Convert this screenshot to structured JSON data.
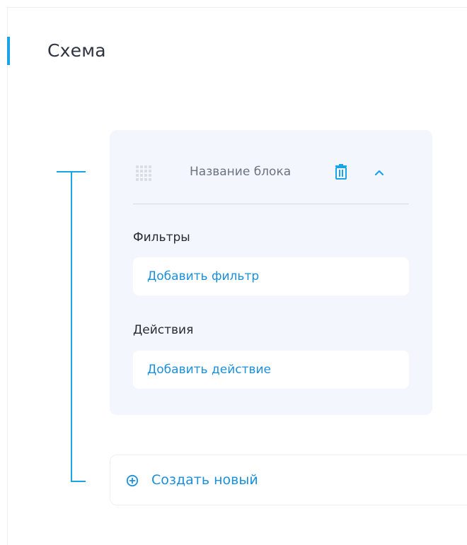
{
  "page": {
    "title": "Схема",
    "accent_color": "#1ba3e8",
    "link_color": "#1b8fd9"
  },
  "block": {
    "name": "Название блока",
    "drag_icon": "drag-handle-icon",
    "delete_icon": "trash-icon",
    "collapse_icon": "chevron-up-icon",
    "filters": {
      "label": "Фильтры",
      "add_label": "Добавить фильтр"
    },
    "actions": {
      "label": "Действия",
      "add_label": "Добавить действие"
    }
  },
  "create_new": {
    "icon": "plus-circle-icon",
    "label": "Создать новый"
  }
}
